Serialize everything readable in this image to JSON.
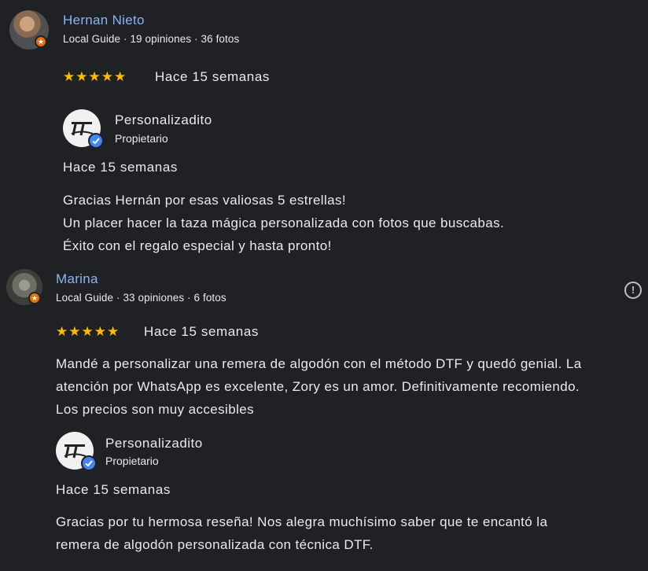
{
  "reviews": [
    {
      "author": "Hernan Nieto",
      "meta": "Local Guide · 19 opiniones · 36 fotos",
      "stars": "★★★★★",
      "rating": 5,
      "time": "Hace 15 semanas",
      "reply": {
        "owner": "Personalizadito",
        "role": "Propietario",
        "time": "Hace 15 semanas",
        "text": "Gracias Hernán por esas valiosas 5 estrellas!\nUn placer hacer la taza mágica personalizada con fotos que buscabas.\nÉxito con el regalo especial y hasta pronto!"
      }
    },
    {
      "author": "Marina",
      "meta": "Local Guide · 33 opiniones · 6 fotos",
      "stars": "★★★★★",
      "rating": 5,
      "time": "Hace 15 semanas",
      "text": "Mandé a personalizar una remera de algodón con el método DTF y quedó genial. La\natención por WhatsApp es excelente, Zory es un amor. Definitivamente recomiendo.\nLos precios son muy accesibles",
      "reply": {
        "owner": "Personalizadito",
        "role": "Propietario",
        "time": "Hace 15 semanas",
        "text": "Gracias por tu hermosa reseña! Nos alegra muchísimo saber que te encantó la\nremera de algodón personalizada con técnica DTF."
      }
    }
  ],
  "colors": {
    "background": "#202124",
    "link": "#8ab4f8",
    "star": "#fbbc04",
    "verified": "#4285f4",
    "guide_badge": "#e8710a"
  },
  "icons": {
    "guide_badge": "star-badge-icon",
    "verified": "verified-check-icon",
    "report": "report-flag-icon"
  }
}
